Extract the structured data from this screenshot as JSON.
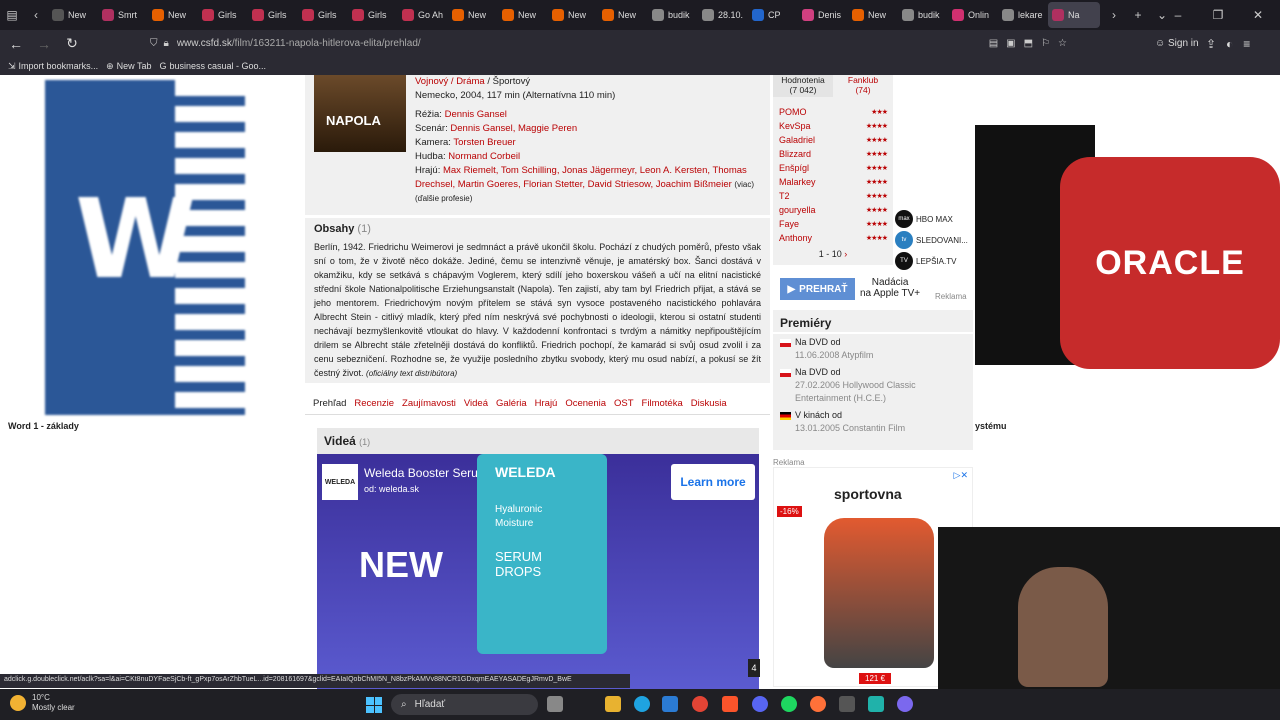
{
  "browser": {
    "tabs": [
      {
        "label": "New",
        "color": "#555"
      },
      {
        "label": "Smrt",
        "color": "#b03060"
      },
      {
        "label": "New",
        "color": "#e66000"
      },
      {
        "label": "Girls",
        "color": "#c03050"
      },
      {
        "label": "Girls",
        "color": "#c03050"
      },
      {
        "label": "Girls",
        "color": "#c03050"
      },
      {
        "label": "Girls",
        "color": "#c03050"
      },
      {
        "label": "Go Ah",
        "color": "#c03050"
      },
      {
        "label": "New",
        "color": "#e66000"
      },
      {
        "label": "New",
        "color": "#e66000"
      },
      {
        "label": "New",
        "color": "#e66000"
      },
      {
        "label": "New",
        "color": "#e66000"
      },
      {
        "label": "budik",
        "color": "#888"
      },
      {
        "label": "28.10.",
        "color": "#888"
      },
      {
        "label": "CP",
        "color": "#2266cc"
      },
      {
        "label": "Denis",
        "color": "#d04080"
      },
      {
        "label": "New",
        "color": "#e66000"
      },
      {
        "label": "budik",
        "color": "#888"
      },
      {
        "label": "Onlin",
        "color": "#d03070"
      },
      {
        "label": "lekare",
        "color": "#888"
      },
      {
        "label": "Na",
        "color": "#b03060"
      }
    ],
    "url_host": "www.csfd.sk",
    "url_path": "/film/163211-napola-hitlerova-elita/prehlad/",
    "sign_in": "Sign in",
    "bookmarks": [
      "Import bookmarks...",
      "New Tab",
      "business casual - Goo..."
    ]
  },
  "background": {
    "word_caption": "Word 1 - základy",
    "oracle_caption": "ystému",
    "oracle_logo": "ORACLE",
    "word_letter": "W"
  },
  "movie": {
    "poster_title": "NAPOLA",
    "genres_linked": "Vojnový / Dráma",
    "genres_plain": " / Športový",
    "origin": "Nemecko, 2004, 117 min (Alternatívna 110 min)",
    "director_label": "Réžia:",
    "director": "Dennis Gansel",
    "screenplay_label": "Scenár:",
    "screenplay": "Dennis Gansel, Maggie Peren",
    "camera_label": "Kamera:",
    "camera": "Torsten Breuer",
    "music_label": "Hudba:",
    "music": "Normand Corbeil",
    "cast_label": "Hrajú:",
    "cast": "Max Riemelt, Tom Schilling, Jonas Jägermeyr, Leon A. Kersten, Thomas Drechsel, Martin Goeres, Florian Stetter, David Striesow, Joachim Bißmeier",
    "cast_more": "(viac)",
    "more_professions": "(ďalšie profesie)",
    "plot_title": "Obsahy",
    "plot_count": "(1)",
    "plot": "Berlín, 1942. Friedrichu Weimerovi je sedmnáct a právě ukončil školu. Pochází z chudých poměrů, přesto však sní o tom, že v životě něco dokáže. Jediné, čemu se intenzivně věnuje, je amatérský box. Šanci dostává v okamžiku, kdy se setkává s chápavým Voglerem, který sdílí jeho boxerskou vášeň a učí na elitní nacistické střední škole Nationalpolitische Erziehungsanstalt (Napola). Ten zajistí, aby tam byl Friedrich přijat, a stává se jeho mentorem. Friedrichovým novým přítelem se stává syn vysoce postaveného nacistického pohlavára Albrecht Stein - citlivý mladík, který před ním neskrývá své pochybnosti o ideologii, kterou si ostatní studenti nechávají bezmyšlenkovitě vtloukat do hlavy. V každodenní konfrontaci s tvrdým a námitky nepřipouštějícím drilem se Albrecht stále zřetelněji dostává do konfliktů. Friedrich pochopí, že kamarád si svůj osud zvolil i za cenu sebezničení. Rozhodne se, že využije posledního zbytku svobody, který mu osud nabízí, a pokusí se žít čestný život.",
    "plot_source": "(oficiálny text distribútora)",
    "subtabs": [
      "Prehľad",
      "Recenzie",
      "Zaujímavosti",
      "Videá",
      "Galéria",
      "Hrajú",
      "Ocenenia",
      "OST",
      "Filmotéka",
      "Diskusia"
    ],
    "videos_title": "Videá",
    "videos_count": "(1)"
  },
  "ad": {
    "logo": "WELEDA",
    "title": "Weleda Booster Serum Drops",
    "source": "od: weleda.sk",
    "cta": "Learn more",
    "headline": "NEW",
    "bottle_lines": [
      "WELEDA",
      "Hyaluronic",
      "Moisture",
      "SERUM",
      "DROPS"
    ],
    "page_num": "4"
  },
  "sidebar": {
    "rating_tab": "Hodnotenia",
    "rating_count": "(7 042)",
    "fanclub_tab": "Fanklub",
    "fanclub_count": "(74)",
    "ratings": [
      {
        "user": "POMO",
        "stars": "★★★"
      },
      {
        "user": "KevSpa",
        "stars": "★★★★"
      },
      {
        "user": "Galadriel",
        "stars": "★★★★"
      },
      {
        "user": "Blizzard",
        "stars": "★★★★"
      },
      {
        "user": "Enšpígl",
        "stars": "★★★★"
      },
      {
        "user": "Malarkey",
        "stars": "★★★★"
      },
      {
        "user": "T2",
        "stars": "★★★★"
      },
      {
        "user": "gouryella",
        "stars": "★★★★"
      },
      {
        "user": "Faye",
        "stars": "★★★★"
      },
      {
        "user": "Anthony",
        "stars": "★★★★"
      }
    ],
    "pager": "1 - 10",
    "streaming": [
      "HBO MAX",
      "SLEDOVANI...",
      "LEPŠIA.TV"
    ],
    "play": "PREHRAŤ",
    "apple_line1": "Nadácia",
    "apple_line2": "na Apple TV+",
    "reklama": "Reklama",
    "premiery_title": "Premiéry",
    "premiery": [
      {
        "label": "Na DVD od",
        "date": "11.06.2008 Atypfilm",
        "flag": "cz"
      },
      {
        "label": "Na DVD od",
        "date": "27.02.2006 Hollywood Classic Entertainment (H.C.E.)",
        "flag": "cz"
      },
      {
        "label": "V kinách od",
        "date": "13.01.2005 Constantin Film",
        "flag": "de"
      }
    ],
    "shoe_brand": "sportovna",
    "shoe_discount": "-16%",
    "shoe_price": "121 €"
  },
  "status_url": "adclick.g.doubleclick.net/aclk?sa=l&ai=CKt8nuDYFaeSjCb-ft_gPxp7osArZhbTueL...id=208161697&gclid=EAIaIQobChMI5N_N8bzPkAMVv88NCR1GDxqmEAEYASADEgJRmvD_BwE",
  "taskbar": {
    "temp": "10°C",
    "weather": "Mostly clear",
    "search": "Hľadať"
  }
}
